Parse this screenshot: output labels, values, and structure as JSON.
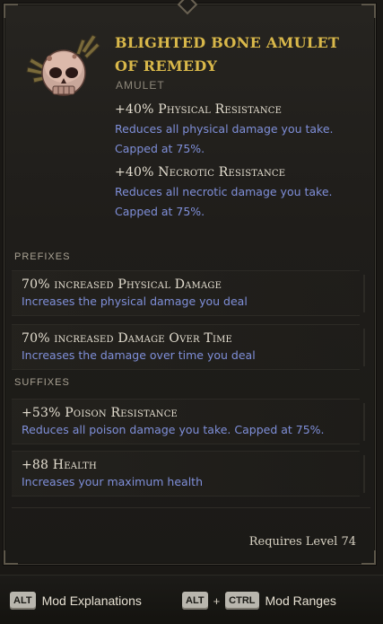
{
  "item": {
    "name": "Blighted Bone Amulet of Remedy",
    "type": "Amulet",
    "icon": "skull-amulet-icon",
    "implicits": [
      {
        "title": "+40% Physical Resistance",
        "description": "Reduces all physical damage you take. Capped at 75%."
      },
      {
        "title": "+40% Necrotic Resistance",
        "description": "Reduces all necrotic damage you take. Capped at 75%."
      }
    ]
  },
  "prefixes": {
    "label": "Prefixes",
    "mods": [
      {
        "title": "70% increased Physical Damage",
        "description": "Increases the physical damage you deal"
      },
      {
        "title": "70% increased Damage Over Time",
        "description": "Increases the damage over time you deal"
      }
    ]
  },
  "suffixes": {
    "label": "Suffixes",
    "mods": [
      {
        "title": "+53% Poison Resistance",
        "description": "Reduces all poison damage you take. Capped at 75%."
      },
      {
        "title": "+88 Health",
        "description": "Increases your maximum health"
      }
    ]
  },
  "requirement": "Requires Level 74",
  "footer": {
    "mod_explanations": {
      "key": "ALT",
      "label": "Mod Explanations"
    },
    "mod_ranges": {
      "key1": "ALT",
      "plus": "+",
      "key2": "CTRL",
      "label": "Mod Ranges"
    }
  },
  "colors": {
    "name": "#d9b84a",
    "description": "#7f8fd9",
    "mod_title": "#e4ded0",
    "type": "#8d877a"
  }
}
